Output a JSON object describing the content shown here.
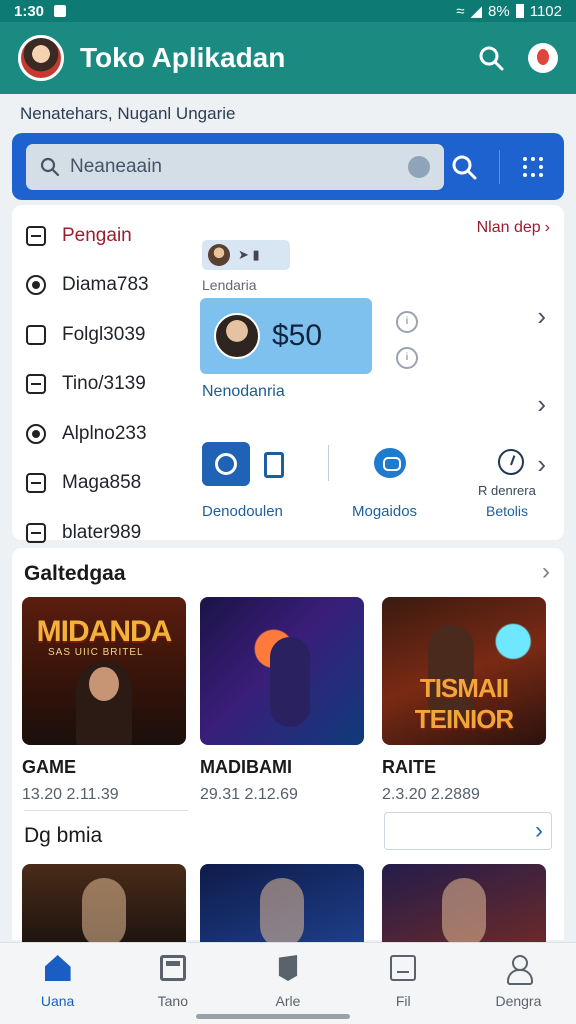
{
  "status_bar": {
    "time": "1:30",
    "battery_text": "8%",
    "clock_right": "1102"
  },
  "app_bar": {
    "title": "Toko Aplikadan"
  },
  "subtitle": "Nenatehars, Nuganl Ungarie",
  "search": {
    "placeholder": "Neaneaain"
  },
  "categories": [
    {
      "label": "Pengain",
      "icon": "doc-icon"
    },
    {
      "label": "Diama783",
      "icon": "radio-icon"
    },
    {
      "label": "Folgl3039",
      "icon": "checkbox-icon"
    },
    {
      "label": "Tino/3139",
      "icon": "doc-icon"
    },
    {
      "label": "Alplno233",
      "icon": "radio-icon"
    },
    {
      "label": "Maga858",
      "icon": "doc-icon"
    },
    {
      "label": "blater989",
      "icon": "doc-icon"
    }
  ],
  "featured": {
    "more_link": "Nlan dep",
    "chip_label": "Lendaria",
    "price": "$50",
    "mid_label": "Nenodanria",
    "tools": {
      "left_label": "Denodoulen",
      "mid_label": "Mogaidos",
      "right_top": "R denrera",
      "right_bottom": "Betolis"
    }
  },
  "section": {
    "title": "Galtedgaa",
    "games": [
      {
        "banner": "MIDANDA",
        "banner_sub": "SAS UIIC BRITEL",
        "name": "GAME",
        "meta": "13.20 2.11.39"
      },
      {
        "banner": "",
        "banner_sub": "",
        "name": "MADIBAMI",
        "meta": "29.31 2.12.69"
      },
      {
        "banner": "TISMAII TEINIOR",
        "banner_sub": "",
        "name": "RAITE",
        "meta": "2.3.20 2.2889"
      }
    ],
    "sub_title": "Dg bmia"
  },
  "bottom_nav": [
    {
      "label": "Uana",
      "icon": "home-icon"
    },
    {
      "label": "Tano",
      "icon": "tv-icon"
    },
    {
      "label": "Arle",
      "icon": "pen-icon"
    },
    {
      "label": "Fil",
      "icon": "doc-icon"
    },
    {
      "label": "Dengra",
      "icon": "user-icon"
    }
  ],
  "colors": {
    "app_bar": "#1b8a80",
    "search_bar": "#1e62cf",
    "accent": "#9b1d2e",
    "active_nav": "#1a5ec4"
  }
}
